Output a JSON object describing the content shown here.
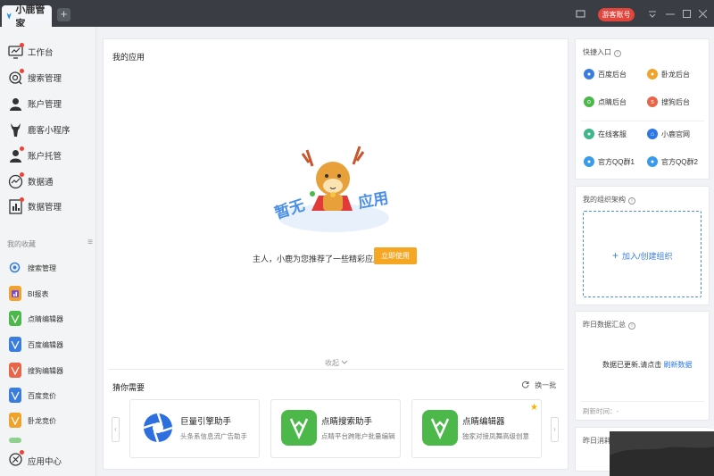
{
  "titlebar": {
    "tab_title": "小鹿管家",
    "add_tab": "+",
    "guest_label": "游客账号",
    "colors": {
      "bar": "#3a3d43",
      "guest": "#e2453c"
    }
  },
  "sidebar": {
    "nav": [
      {
        "label": "工作台",
        "icon": "monitor-chart-icon",
        "dot": true
      },
      {
        "label": "搜索管理",
        "icon": "search-target-icon",
        "dot": true
      },
      {
        "label": "账户管理",
        "icon": "user-account-icon",
        "dot": false
      },
      {
        "label": "鹿客小程序",
        "icon": "deer-icon",
        "dot": false
      },
      {
        "label": "账户托管",
        "icon": "user-hosting-icon",
        "dot": true
      },
      {
        "label": "数据通",
        "icon": "data-gauge-icon",
        "dot": true
      },
      {
        "label": "数据管理",
        "icon": "data-bars-icon",
        "dot": true
      }
    ],
    "favorites_label": "我的收藏",
    "favorites": [
      {
        "label": "搜索管理",
        "icon": "search-target-icon",
        "color": "#3b7ddd"
      },
      {
        "label": "BI报表",
        "icon": "bi-report-icon",
        "color": "#f0a32a"
      },
      {
        "label": "点睛编辑器",
        "icon": "dianjing-editor-icon",
        "color": "#4cb84a"
      },
      {
        "label": "百度编辑器",
        "icon": "baidu-editor-icon",
        "color": "#3b7ddd"
      },
      {
        "label": "搜狗编辑器",
        "icon": "sogou-editor-icon",
        "color": "#e8654a"
      },
      {
        "label": "百度竞价",
        "icon": "baidu-bid-icon",
        "color": "#3b7ddd"
      },
      {
        "label": "卧龙竞价",
        "icon": "wolong-bid-icon",
        "color": "#f0a32a"
      }
    ],
    "app_center": "应用中心"
  },
  "main": {
    "title": "我的应用",
    "empty_art_left": "暂无",
    "empty_art_right": "应用",
    "empty_text": "主人，小鹿为您推荐了一些精彩应用",
    "use_button": "立即使用",
    "collapse": "收起",
    "guess_title": "猜你需要",
    "refresh_label": "换一批",
    "cards": [
      {
        "name": "巨量引擎助手",
        "desc": "头条系信息流广告助手",
        "icon": "juliang-engine-icon",
        "color": "#2e6fe0",
        "starred": false
      },
      {
        "name": "点睛搜索助手",
        "desc": "点睛平台跨账户批量编辑",
        "icon": "dianjing-search-icon",
        "color": "#4cb84a",
        "starred": false
      },
      {
        "name": "点睛编辑器",
        "desc": "独家对接凤舞高级创意",
        "icon": "dianjing-editor-icon",
        "color": "#4cb84a",
        "starred": true
      }
    ]
  },
  "quick": {
    "title": "快捷入口",
    "links": [
      {
        "label": "百度后台",
        "icon": "baidu-paw-icon",
        "color": "#3b7ddd"
      },
      {
        "label": "卧龙后台",
        "icon": "wolong-icon",
        "color": "#f0a32a"
      },
      {
        "label": "点睛后台",
        "icon": "dianjing-icon",
        "color": "#4cb84a"
      },
      {
        "label": "搜狗后台",
        "icon": "sogou-icon",
        "color": "#e8654a"
      },
      {
        "label": "在线客服",
        "icon": "chat-service-icon",
        "color": "#3fb58a"
      },
      {
        "label": "小鹿官网",
        "icon": "home-icon",
        "color": "#2b78e4"
      },
      {
        "label": "官方QQ群1",
        "icon": "qq-icon",
        "color": "#3a9bea"
      },
      {
        "label": "官方QQ群2",
        "icon": "qq-icon",
        "color": "#3a9bea"
      }
    ]
  },
  "org": {
    "title": "我的组织架构",
    "add_label": "加入/创建组织"
  },
  "yesterday": {
    "title": "昨日数据汇总",
    "msg": "数据已更新,请点击",
    "link": "刷新数据",
    "refresh_time": "刷新时间：-"
  },
  "partial_panel": {
    "title": "昨日消耗"
  }
}
